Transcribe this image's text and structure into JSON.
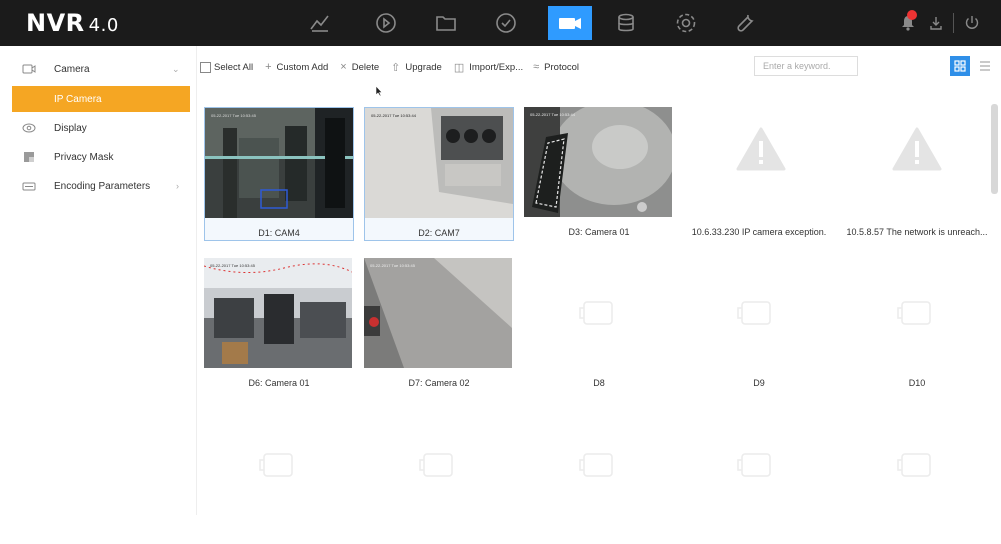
{
  "header": {
    "logo": "NVR",
    "version": "4.0",
    "nav_icons": [
      "live-view-icon",
      "playback-icon",
      "file-management-icon",
      "smart-analysis-icon",
      "camera-icon",
      "storage-icon",
      "system-icon",
      "maintenance-icon"
    ],
    "active_nav": "camera-icon",
    "right_icons": [
      "notification-icon",
      "export-icon",
      "power-icon"
    ],
    "accent_color": "#2f9bff"
  },
  "sidebar": {
    "items": [
      {
        "label": "Camera",
        "icon": "camera-icon",
        "expanded": true
      },
      {
        "label": "IP Camera",
        "active": true
      },
      {
        "label": "Display",
        "icon": "eye-icon"
      },
      {
        "label": "Privacy Mask",
        "icon": "mask-icon"
      },
      {
        "label": "Encoding Parameters",
        "icon": "encoding-icon"
      }
    ],
    "active_color": "#f5a623"
  },
  "toolbar": {
    "select_all": "Select All",
    "custom_add": "Custom Add",
    "delete": "Delete",
    "upgrade": "Upgrade",
    "import_export": "Import/Exp...",
    "protocol": "Protocol",
    "search_placeholder": "Enter a keyword."
  },
  "tiles": [
    {
      "label": "D1: CAM4",
      "type": "live",
      "selected": true
    },
    {
      "label": "D2: CAM7",
      "type": "live",
      "selected": true
    },
    {
      "label": "D3: Camera 01",
      "type": "live"
    },
    {
      "label": "10.6.33.230 IP camera exception.",
      "type": "warning"
    },
    {
      "label": "10.5.8.57 The network is unreach...",
      "type": "warning"
    },
    {
      "label": "D6: Camera 01",
      "type": "live"
    },
    {
      "label": "D7: Camera 02",
      "type": "live"
    },
    {
      "label": "D8",
      "type": "empty"
    },
    {
      "label": "D9",
      "type": "empty"
    },
    {
      "label": "D10",
      "type": "empty"
    },
    {
      "label": "",
      "type": "empty"
    },
    {
      "label": "",
      "type": "empty"
    },
    {
      "label": "",
      "type": "empty"
    },
    {
      "label": "",
      "type": "empty"
    },
    {
      "label": "",
      "type": "empty"
    }
  ]
}
